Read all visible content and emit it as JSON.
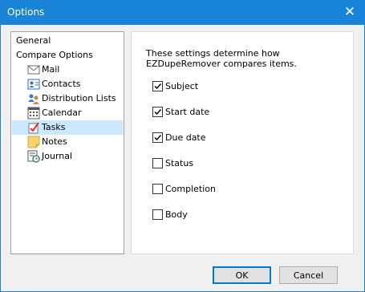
{
  "window": {
    "title": "Options"
  },
  "tree": {
    "items": [
      {
        "label": "General",
        "icon": "none"
      },
      {
        "label": "Compare Options",
        "icon": "none"
      },
      {
        "label": "Mail",
        "icon": "mail-icon"
      },
      {
        "label": "Contacts",
        "icon": "contacts-icon"
      },
      {
        "label": "Distribution Lists",
        "icon": "distribution-lists-icon"
      },
      {
        "label": "Calendar",
        "icon": "calendar-icon"
      },
      {
        "label": "Tasks",
        "icon": "tasks-icon"
      },
      {
        "label": "Notes",
        "icon": "notes-icon"
      },
      {
        "label": "Journal",
        "icon": "journal-icon"
      }
    ],
    "selected": "Tasks"
  },
  "settings": {
    "description": "These settings determine how EZDupeRemover compares items.",
    "options": [
      {
        "label": "Subject",
        "checked": true
      },
      {
        "label": "Start date",
        "checked": true
      },
      {
        "label": "Due date",
        "checked": true
      },
      {
        "label": "Status",
        "checked": false
      },
      {
        "label": "Completion",
        "checked": false
      },
      {
        "label": "Body",
        "checked": false
      }
    ]
  },
  "buttons": {
    "ok": "OK",
    "cancel": "Cancel"
  },
  "colors": {
    "titlebar": "#1883d7",
    "selection": "#cce8ff",
    "default_button_border": "#0078d7"
  }
}
